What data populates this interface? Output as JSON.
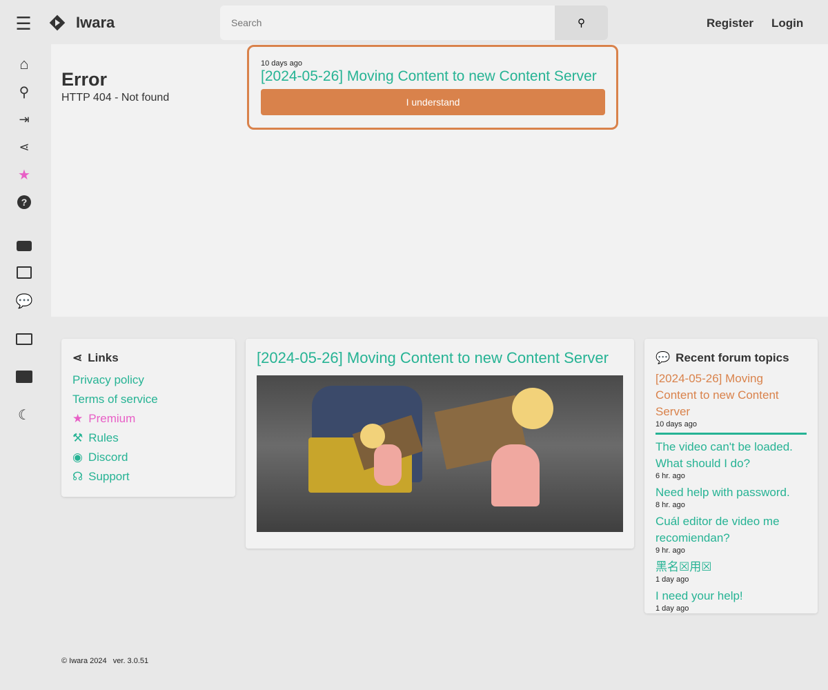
{
  "header": {
    "brand": "Iwara",
    "search_placeholder": "Search",
    "register": "Register",
    "login": "Login"
  },
  "error": {
    "title": "Error",
    "message": "HTTP 404 - Not found"
  },
  "notice": {
    "time": "10 days ago",
    "title": "[2024-05-26] Moving Content to new Content Server",
    "button": "I understand"
  },
  "links": {
    "title": "Links",
    "items": [
      {
        "label": "Privacy policy",
        "icon": ""
      },
      {
        "label": "Terms of service",
        "icon": ""
      },
      {
        "label": "Premium",
        "icon": "star-icon",
        "color": "#e85fc6"
      },
      {
        "label": "Rules",
        "icon": "gavel-icon"
      },
      {
        "label": "Discord",
        "icon": "discord-icon"
      },
      {
        "label": "Support",
        "icon": "headset-icon"
      }
    ]
  },
  "news": {
    "title": "[2024-05-26] Moving Content to new Content Server"
  },
  "forum": {
    "title": "Recent forum topics",
    "pinned": {
      "title": "[2024-05-26] Moving Content to new Content Server",
      "time": "10 days ago"
    },
    "topics": [
      {
        "title": "The video can't be loaded. What should I do?",
        "time": "6 hr. ago"
      },
      {
        "title": "Need help with password.",
        "time": "8 hr. ago"
      },
      {
        "title": "Cuál editor de video me recomiendan?",
        "time": "9 hr. ago"
      },
      {
        "title": "黑名☒用☒",
        "time": "1 day ago"
      },
      {
        "title": "I need your help!",
        "time": "1 day ago"
      }
    ]
  },
  "footer": {
    "copyright": "© Iwara 2024",
    "version": "ver. 3.0.51"
  },
  "colors": {
    "accent": "#26b394",
    "orange": "#d9824b",
    "premium": "#e85fc6"
  }
}
